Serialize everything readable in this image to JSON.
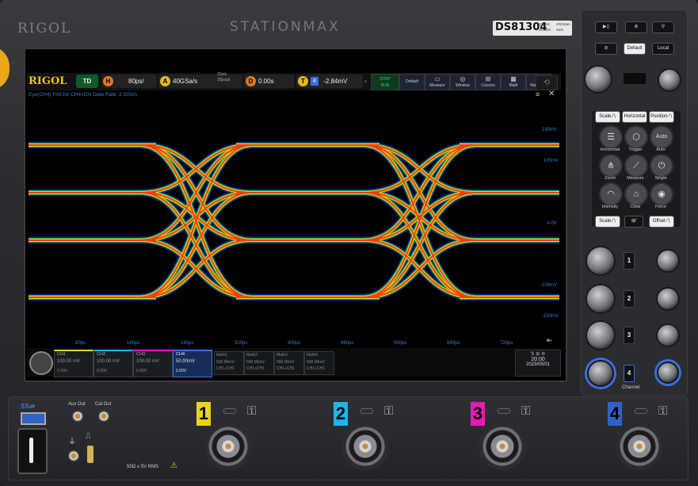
{
  "bezel": {
    "brand": "RIGOL",
    "series": "STATIONMAX",
    "model": "DS81304",
    "spec1a": "13GHz",
    "spec1b": "40GSa/s",
    "spec2a": "4GSa/s",
    "spec2b": "Sa/s"
  },
  "topbar": {
    "brand": "RIGOL",
    "mode": "TD",
    "h_label": "H",
    "timebase": "80ps/",
    "a_label": "A",
    "sample_rate": "40GSa/s",
    "mem_depth": "32pts",
    "pts": "25ps/pt",
    "d_label": "D",
    "delay": "0.00s",
    "t_label": "T",
    "trig_ch": "4",
    "trig_level": "-2.84mV",
    "run_state": "STOP",
    "run_sub": "RUN",
    "default_btn": "Default",
    "tools": [
      "Measure",
      "Window",
      "Cursors",
      "Math",
      "WaveGen"
    ]
  },
  "status_line": "Eye(CH4)    Fmt:Hz    CH4:IChi    Data Rate: 2.5Gb/s",
  "right_scale": [
    "150mV",
    "100mV",
    "4-0V",
    "-100mV",
    "-150mV"
  ],
  "x_ticks": [
    "80ps",
    "160ps",
    "240ps",
    "320ps",
    "400ps",
    "480ps",
    "560ps",
    "640ps",
    "720ps"
  ],
  "channels": [
    {
      "name": "CH1",
      "scale": "100.00 mV",
      "offset": "0.00V",
      "color": "#e8d51a"
    },
    {
      "name": "CH2",
      "scale": "100.00 mV",
      "offset": "0.00V",
      "color": "#1ab6e8"
    },
    {
      "name": "CH3",
      "scale": "100.00 mV",
      "offset": "0.00V",
      "color": "#e81ab6"
    },
    {
      "name": "CH4",
      "scale": "50.00mV",
      "offset": "0.00V",
      "color": "#3a6fe0"
    }
  ],
  "math": [
    {
      "name": "Math1",
      "scale": "500.00mV",
      "src": "CH1+CH1"
    },
    {
      "name": "Math2",
      "scale": "500.00mV",
      "src": "CH1+CH1"
    },
    {
      "name": "Math3",
      "scale": "500.00mV",
      "src": "CH1+CH1"
    },
    {
      "name": "Math4",
      "scale": "500.00mV",
      "src": "CH1+CH1"
    }
  ],
  "clock": {
    "time": "20:00",
    "date": "2023/05/01"
  },
  "panel": {
    "default": "Default",
    "local": "Local",
    "scale_h": "Scale",
    "horizontal": "Horizontal",
    "position": "Position",
    "keys": [
      "Horizontal",
      "Trigger",
      "Auto",
      "Zoom",
      "Measure",
      "Single",
      "Intensity",
      "Clear",
      "Force"
    ],
    "scale_v": "Scale",
    "offset": "Offset",
    "channel_label": "Channel",
    "channel_nums": [
      "1",
      "2",
      "3",
      "4"
    ]
  },
  "front": {
    "aux_out": "Aux Out",
    "cal_out": "Cal Out",
    "rating": "50Ω ≤ 5V RMS",
    "input_nums": [
      "1",
      "2",
      "3",
      "4"
    ]
  }
}
